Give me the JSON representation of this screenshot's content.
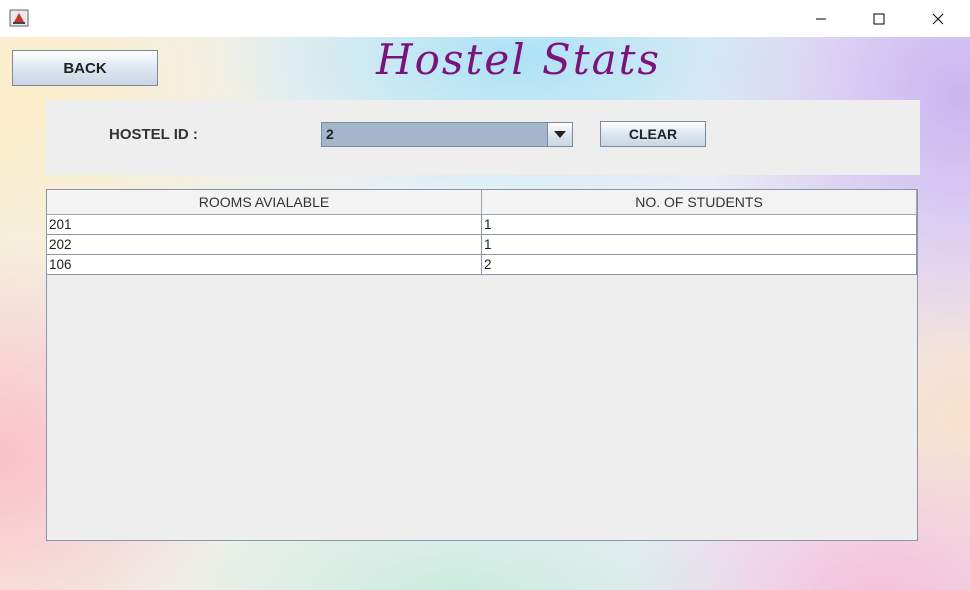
{
  "window": {
    "icons": {
      "app": "java-cup-icon",
      "minimize": "minimize-icon",
      "maximize": "maximize-icon",
      "close": "close-icon"
    }
  },
  "header": {
    "back_label": "BACK",
    "title": "Hostel Stats",
    "title_color": "#7a137a"
  },
  "filter": {
    "hostel_id_label": "HOSTEL ID :",
    "hostel_id_value": "2",
    "clear_label": "CLEAR"
  },
  "table": {
    "columns": [
      "ROOMS AVIALABLE",
      "NO. OF STUDENTS"
    ],
    "rows": [
      [
        "201",
        "1"
      ],
      [
        "202",
        "1"
      ],
      [
        "106",
        "2"
      ]
    ]
  }
}
